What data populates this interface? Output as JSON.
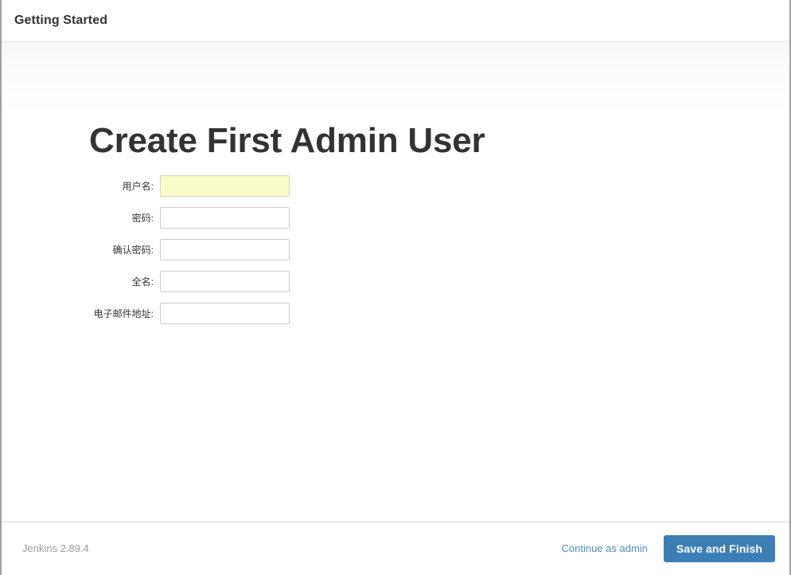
{
  "header": {
    "title": "Getting Started"
  },
  "main": {
    "title": "Create First Admin User",
    "fields": [
      {
        "label": "用户名:",
        "name": "username",
        "type": "text",
        "value": "",
        "autofilled": true
      },
      {
        "label": "密码:",
        "name": "password",
        "type": "password",
        "value": "",
        "autofilled": false
      },
      {
        "label": "确认密码:",
        "name": "confirm-password",
        "type": "password",
        "value": "",
        "autofilled": false
      },
      {
        "label": "全名:",
        "name": "fullname",
        "type": "text",
        "value": "",
        "autofilled": false
      },
      {
        "label": "电子邮件地址:",
        "name": "email",
        "type": "text",
        "value": "",
        "autofilled": false
      }
    ]
  },
  "footer": {
    "version": "Jenkins 2.89.4",
    "continue_link": "Continue as admin",
    "save_button": "Save and Finish"
  },
  "colors": {
    "accent": "#3c7fb7",
    "link": "#4b8fc4",
    "autofill_background": "#f9fbc8",
    "text": "#333333",
    "muted_text": "#9a9a9a"
  }
}
